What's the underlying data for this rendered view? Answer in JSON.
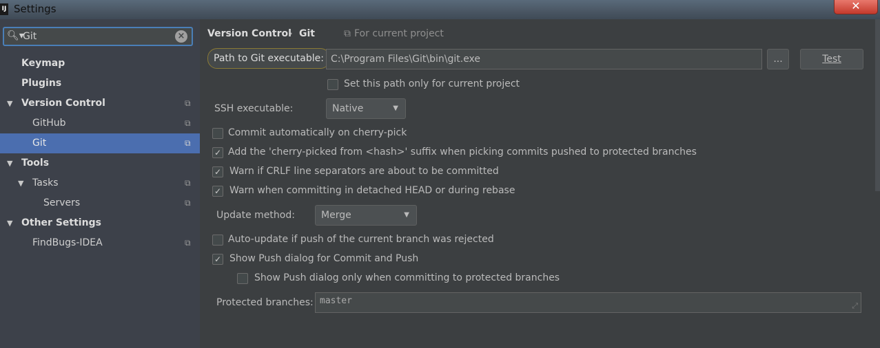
{
  "window": {
    "icon_text": "IJ",
    "title": "Settings",
    "close_label": "✕"
  },
  "search": {
    "value": "Git",
    "placeholder": ""
  },
  "tree": [
    {
      "label": "Keymap"
    },
    {
      "label": "Plugins"
    },
    {
      "label": "Version Control"
    },
    {
      "label": "GitHub"
    },
    {
      "label": "Git"
    },
    {
      "label": "Tools"
    },
    {
      "label": "Tasks"
    },
    {
      "label": "Servers"
    },
    {
      "label": "Other Settings"
    },
    {
      "label": "FindBugs-IDEA"
    }
  ],
  "breadcrumb": {
    "parent": "Version Control",
    "separator": "›",
    "current": "Git",
    "scope": "For current project"
  },
  "git": {
    "path_label": "Path to Git executable:",
    "path_value": "C:\\Program Files\\Git\\bin\\git.exe",
    "browse_label": "...",
    "test_label": "Test",
    "path_only_project": "Set this path only for current project",
    "ssh_label": "SSH executable:",
    "ssh_value": "Native",
    "commit_cherry_pick": "Commit automatically on cherry-pick",
    "cherry_suffix": "Add the 'cherry-picked from <hash>' suffix when picking commits pushed to protected branches",
    "warn_crlf": "Warn if CRLF line separators are about to be committed",
    "warn_detached": "Warn when committing in detached HEAD or during rebase",
    "update_label": "Update method:",
    "update_value": "Merge",
    "auto_update": "Auto-update if push of the current branch was rejected",
    "show_push": "Show Push dialog for Commit and Push",
    "show_push_protected": "Show Push dialog only when committing to protected branches",
    "protected_label": "Protected branches:",
    "protected_value": "master"
  },
  "checkbox_states": {
    "path_only_project": false,
    "commit_cherry_pick": false,
    "cherry_suffix": true,
    "warn_crlf": true,
    "warn_detached": true,
    "auto_update": false,
    "show_push": true,
    "show_push_protected": false
  },
  "colors": {
    "selection": "#4b6eaf",
    "accent": "#4a7fb8",
    "background": "#3c3f41"
  }
}
